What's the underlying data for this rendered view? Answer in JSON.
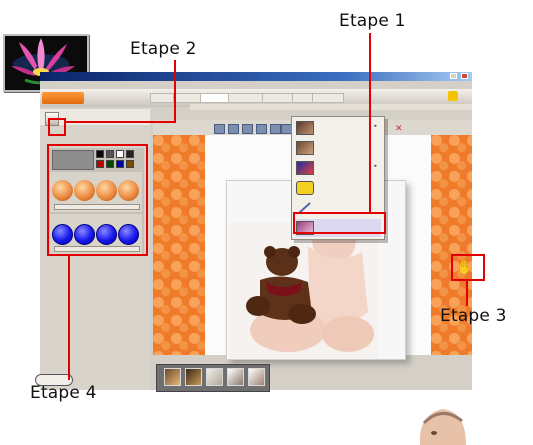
{
  "annotations": {
    "etape1": "Etape 1",
    "etape2": "Etape 2",
    "etape3": "Etape 3",
    "etape4": "Etape 4"
  },
  "colors": {
    "callout": "#e30000",
    "canvas_orange": "#ee7a2a",
    "title_bar": "#0a246a"
  },
  "window": {
    "title_icon": "lotus-flower-icon"
  },
  "menu": {
    "items": [
      {
        "icon": "frames-icon",
        "has_submenu": true
      },
      {
        "icon": "color-icon",
        "has_submenu": false
      },
      {
        "icon": "background-icon",
        "has_submenu": true
      },
      {
        "icon": "star-shape-icon",
        "has_submenu": false
      },
      {
        "icon": "pen-signature-icon",
        "has_submenu": false
      },
      {
        "icon": "shadow-effect-icon",
        "has_submenu": false
      }
    ]
  }
}
